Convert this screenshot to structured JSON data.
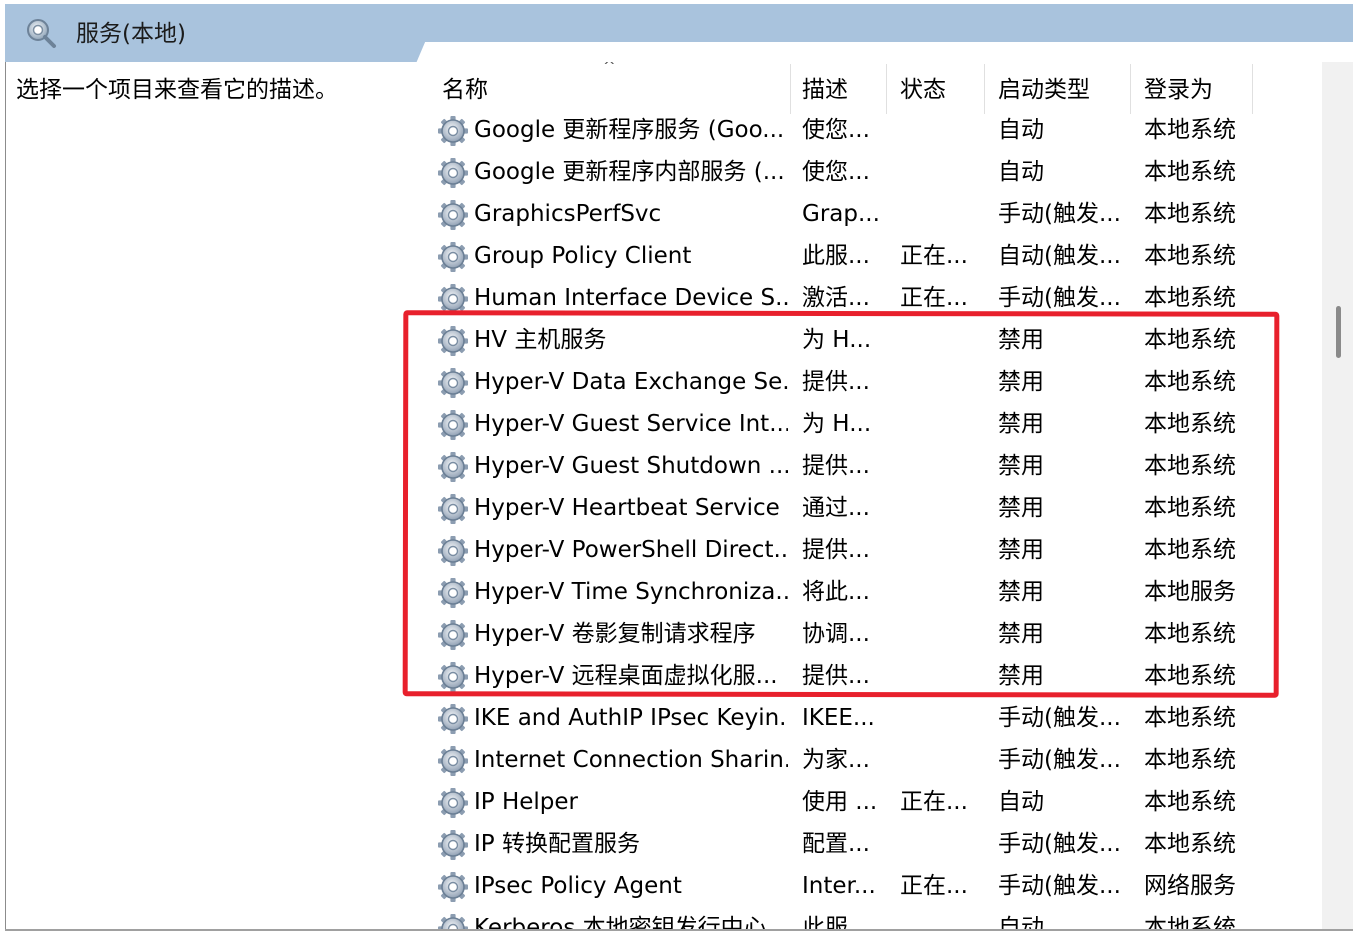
{
  "window": {
    "title": "服务(本地)",
    "icon": "services-gear-magnifier-icon"
  },
  "description_pane": {
    "text": "选择一个项目来查看它的描述。"
  },
  "columns": {
    "name": "名称",
    "description": "描述",
    "status": "状态",
    "startup_type": "启动类型",
    "log_on_as": "登录为",
    "sort_indicator": "^"
  },
  "rows": [
    {
      "name": "Google 更新程序服务 (Goo...",
      "description": "使您...",
      "status": "",
      "startup_type": "自动",
      "log_on_as": "本地系统"
    },
    {
      "name": "Google 更新程序内部服务 (...",
      "description": "使您...",
      "status": "",
      "startup_type": "自动",
      "log_on_as": "本地系统"
    },
    {
      "name": "GraphicsPerfSvc",
      "description": "Grap...",
      "status": "",
      "startup_type": "手动(触发...",
      "log_on_as": "本地系统"
    },
    {
      "name": "Group Policy Client",
      "description": "此服...",
      "status": "正在...",
      "startup_type": "自动(触发...",
      "log_on_as": "本地系统"
    },
    {
      "name": "Human Interface Device S...",
      "description": "激活...",
      "status": "正在...",
      "startup_type": "手动(触发...",
      "log_on_as": "本地系统"
    },
    {
      "name": "HV 主机服务",
      "description": "为 H...",
      "status": "",
      "startup_type": "禁用",
      "log_on_as": "本地系统"
    },
    {
      "name": "Hyper-V Data Exchange Se...",
      "description": "提供...",
      "status": "",
      "startup_type": "禁用",
      "log_on_as": "本地系统"
    },
    {
      "name": "Hyper-V Guest Service Int...",
      "description": "为 H...",
      "status": "",
      "startup_type": "禁用",
      "log_on_as": "本地系统"
    },
    {
      "name": "Hyper-V Guest Shutdown ...",
      "description": "提供...",
      "status": "",
      "startup_type": "禁用",
      "log_on_as": "本地系统"
    },
    {
      "name": "Hyper-V Heartbeat Service",
      "description": "通过...",
      "status": "",
      "startup_type": "禁用",
      "log_on_as": "本地系统"
    },
    {
      "name": "Hyper-V PowerShell Direct...",
      "description": "提供...",
      "status": "",
      "startup_type": "禁用",
      "log_on_as": "本地系统"
    },
    {
      "name": "Hyper-V Time Synchroniza...",
      "description": "将此...",
      "status": "",
      "startup_type": "禁用",
      "log_on_as": "本地服务"
    },
    {
      "name": "Hyper-V 卷影复制请求程序",
      "description": "协调...",
      "status": "",
      "startup_type": "禁用",
      "log_on_as": "本地系统"
    },
    {
      "name": "Hyper-V 远程桌面虚拟化服...",
      "description": "提供...",
      "status": "",
      "startup_type": "禁用",
      "log_on_as": "本地系统"
    },
    {
      "name": "IKE and AuthIP IPsec Keyin...",
      "description": "IKEE...",
      "status": "",
      "startup_type": "手动(触发...",
      "log_on_as": "本地系统"
    },
    {
      "name": "Internet Connection Sharin...",
      "description": "为家...",
      "status": "",
      "startup_type": "手动(触发...",
      "log_on_as": "本地系统"
    },
    {
      "name": "IP Helper",
      "description": "使用 ...",
      "status": "正在...",
      "startup_type": "自动",
      "log_on_as": "本地系统"
    },
    {
      "name": "IP 转换配置服务",
      "description": "配置...",
      "status": "",
      "startup_type": "手动(触发...",
      "log_on_as": "本地系统"
    },
    {
      "name": "IPsec Policy Agent",
      "description": "Inter...",
      "status": "正在...",
      "startup_type": "手动(触发...",
      "log_on_as": "网络服务"
    },
    {
      "name": "Kerberos 本地密钥发行中心",
      "description": "此服...",
      "status": "",
      "startup_type": "自动",
      "log_on_as": "本地系统"
    }
  ],
  "annotation": {
    "color": "#e8202c",
    "highlights_rows": "HV 主机服务 – Hyper-V 远程桌面虚拟化服..."
  },
  "colors": {
    "header_background": "#a9c3dd",
    "annotation_red": "#e8202c"
  }
}
